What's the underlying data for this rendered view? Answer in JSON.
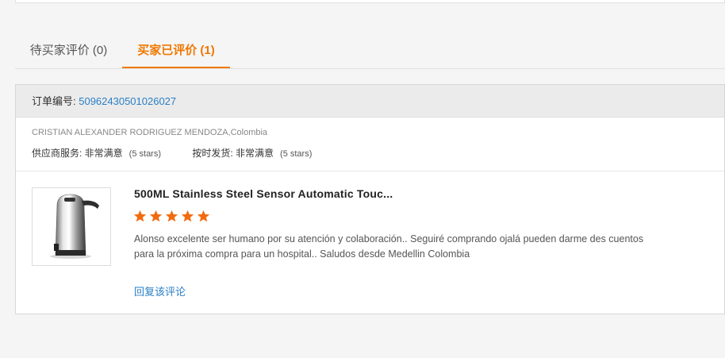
{
  "tabs": [
    {
      "label": "待买家评价 (0)",
      "active": false
    },
    {
      "label": "买家已评价 (1)",
      "active": true
    }
  ],
  "review": {
    "order_label": "订单编号: ",
    "order_number": "50962430501026027",
    "buyer": "CRISTIAN ALEXANDER RODRIGUEZ MENDOZA,Colombia",
    "ratings": [
      {
        "label": "供应商服务: 非常满意",
        "stars_text": "(5 stars)"
      },
      {
        "label": "按时发货: 非常满意",
        "stars_text": "(5 stars)"
      }
    ],
    "product_title": "500ML Stainless Steel Sensor Automatic Touc...",
    "product_image_icon": "soap-dispenser-image",
    "star_rating": 5,
    "star_color": "#f26b0f",
    "comment": "Alonso excelente ser humano por su atención y colaboración.. Seguiré comprando ojalá pueden darme des cuentos para la próxima compra para un hospital.. Saludos desde Medellin Colombia",
    "reply_link": "回复该评论"
  },
  "colors": {
    "accent": "#f07800",
    "link": "#2a7fc6"
  }
}
